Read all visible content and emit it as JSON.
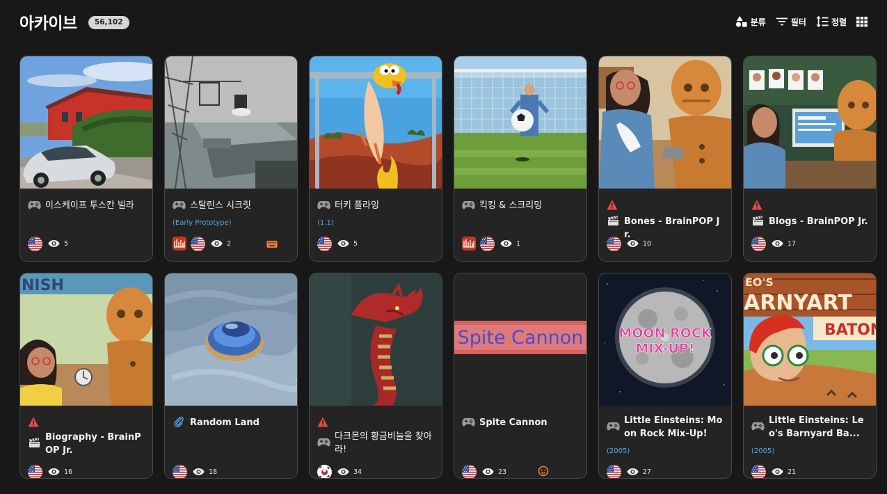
{
  "header": {
    "title": "아카이브",
    "count": "56,102",
    "tools": {
      "classify": "분류",
      "filter": "필터",
      "sort": "정렬"
    }
  },
  "colors": {
    "background": "#181818",
    "card": "#242424",
    "subtitle": "#56a8e6",
    "warning": "#f04848",
    "accent_orange": "#f47d38"
  },
  "cards": [
    {
      "name": "이스케이프 투스칸 빌라",
      "type": "game-icon",
      "flag": "us-flag",
      "views": "5"
    },
    {
      "name": "스탈린스 시크릿",
      "subtitle": "(Early Prototype)",
      "type": "game-icon",
      "platform": "shockwave-icon",
      "flag": "us-flag",
      "views": "2",
      "extra": "keyboard-icon"
    },
    {
      "name": "터키 플라잉",
      "subtitle": "(1.1)",
      "type": "game-icon",
      "flag": "us-flag",
      "views": "5"
    },
    {
      "name": "킥킹 & 스크리밍",
      "type": "game-icon",
      "platform": "shockwave-icon",
      "flag": "us-flag",
      "views": "1"
    },
    {
      "name": "Bones - BrainPOP Jr.",
      "type": "animation-icon",
      "warning": true,
      "flag": "us-flag",
      "views": "10"
    },
    {
      "name": "Blogs - BrainPOP Jr.",
      "type": "animation-icon",
      "warning": true,
      "flag": "us-flag",
      "views": "17"
    },
    {
      "name": "Biography - BrainPOP Jr.",
      "type": "animation-icon",
      "warning": true,
      "flag": "us-flag",
      "views": "16"
    },
    {
      "name": "Random Land",
      "type": "link-icon",
      "flag": "us-flag",
      "views": "18"
    },
    {
      "name": "다크몬의 황금비늘을 찾아라!",
      "type": "game-icon",
      "warning": true,
      "flag": "kr-flag",
      "views": "34"
    },
    {
      "name": "Spite Cannon",
      "type": "game-icon",
      "flag": "us-flag",
      "views": "23",
      "extra": "face-icon",
      "thumb_text": "Spite Cannon"
    },
    {
      "name": "Little Einsteins: Moon Rock Mix-Up!",
      "subtitle": "(2005)",
      "type": "game-icon",
      "flag": "us-flag",
      "views": "27",
      "thumb_text": [
        "MOON ROCK",
        "MIX-UP!"
      ]
    },
    {
      "name": "Little Einsteins: Leo's Barnyard Ba...",
      "subtitle": "(2005)",
      "type": "game-icon",
      "flag": "us-flag",
      "views": "21",
      "thumb_text": [
        "EO'S",
        "ARNYART",
        "BATON"
      ]
    }
  ],
  "thumb_texts": {
    "row1_brainpop_top": "NISH"
  }
}
